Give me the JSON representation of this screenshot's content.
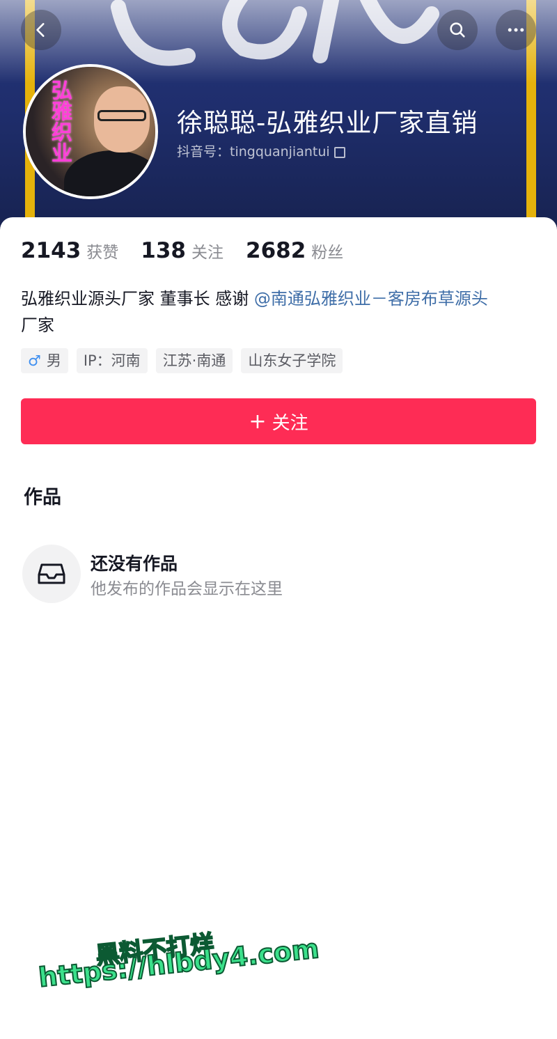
{
  "header": {
    "back_icon": "chevron-left-icon",
    "search_icon": "search-icon",
    "more_icon": "more-horizontal-icon",
    "display_name": "徐聪聪-弘雅织业厂家直销",
    "douyin_id_label": "抖音号：",
    "douyin_id": "tingquanjiantui",
    "avatar_overlay_text": "弘雅织业"
  },
  "stats": [
    {
      "value": "2143",
      "label": "获赞"
    },
    {
      "value": "138",
      "label": "关注"
    },
    {
      "value": "2682",
      "label": "粉丝"
    }
  ],
  "bio": {
    "text": "弘雅织业源头厂家 董事长 感谢 ",
    "mention": "@南通弘雅织业－客房布草源头",
    "text_tail": "厂家"
  },
  "tags": [
    {
      "icon": "♂",
      "label": "男"
    },
    {
      "label": "IP：河南"
    },
    {
      "label": "江苏·南通"
    },
    {
      "label": "山东女子学院"
    }
  ],
  "follow_button": {
    "icon": "+",
    "label": "关注"
  },
  "works": {
    "title": "作品",
    "empty_title": "还没有作品",
    "empty_subtitle": "他发布的作品会显示在这里"
  },
  "watermark": {
    "line1": "黑料不打烊",
    "line2": "https://hlbdy4.com"
  },
  "colors": {
    "accent": "#fe2c55",
    "mention": "#3f6ea8",
    "banner": "#25357a"
  }
}
